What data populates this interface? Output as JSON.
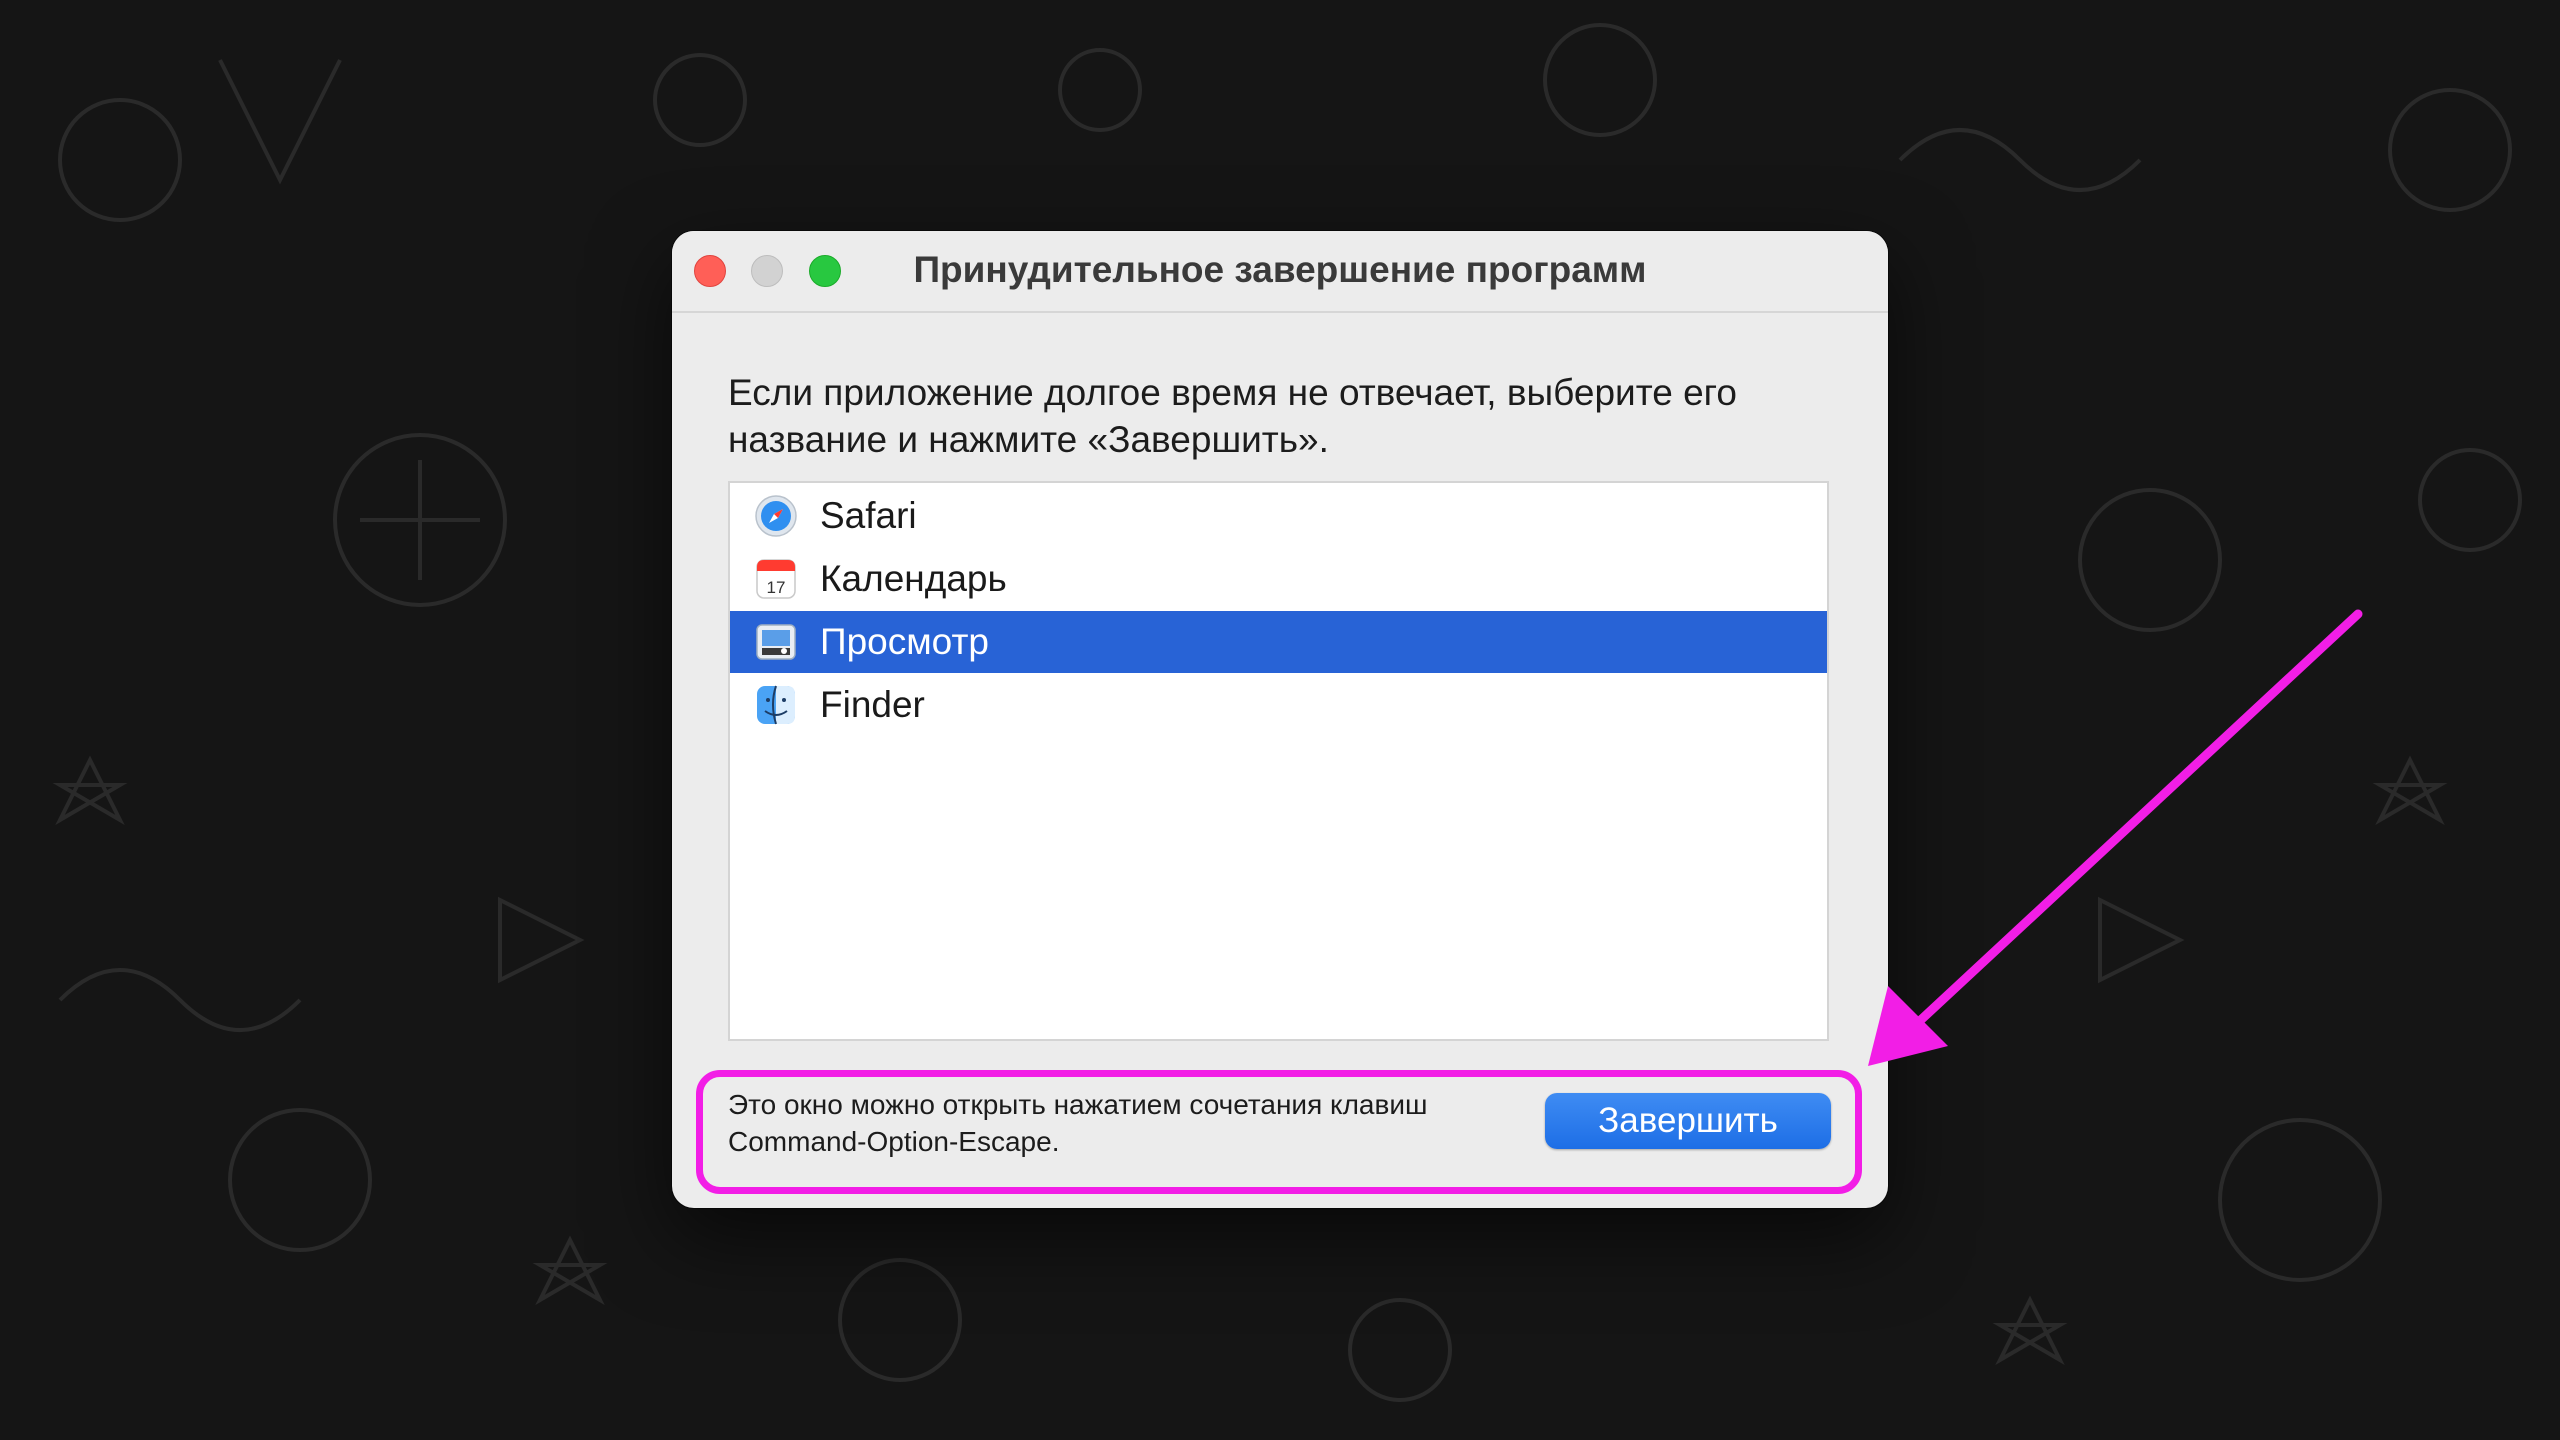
{
  "window": {
    "title": "Принудительное завершение программ",
    "description": "Если приложение долгое время не отвечает, выберите его название и нажмите «Завершить».",
    "footer_text": "Это окно можно открыть нажатием сочетания клавиш Command-Option-Escape.",
    "quit_label": "Завершить"
  },
  "apps": [
    {
      "label": "Safari",
      "icon": "safari-icon",
      "selected": false
    },
    {
      "label": "Календарь",
      "icon": "calendar-icon",
      "selected": false,
      "icon_day": "17"
    },
    {
      "label": "Просмотр",
      "icon": "preview-icon",
      "selected": true
    },
    {
      "label": "Finder",
      "icon": "finder-icon",
      "selected": false
    }
  ],
  "colors": {
    "selection": "#2863d6",
    "accent_button": "#2a7cf0",
    "annotation": "#f21ee6",
    "close": "#ff5f57",
    "maximize": "#28c840"
  }
}
